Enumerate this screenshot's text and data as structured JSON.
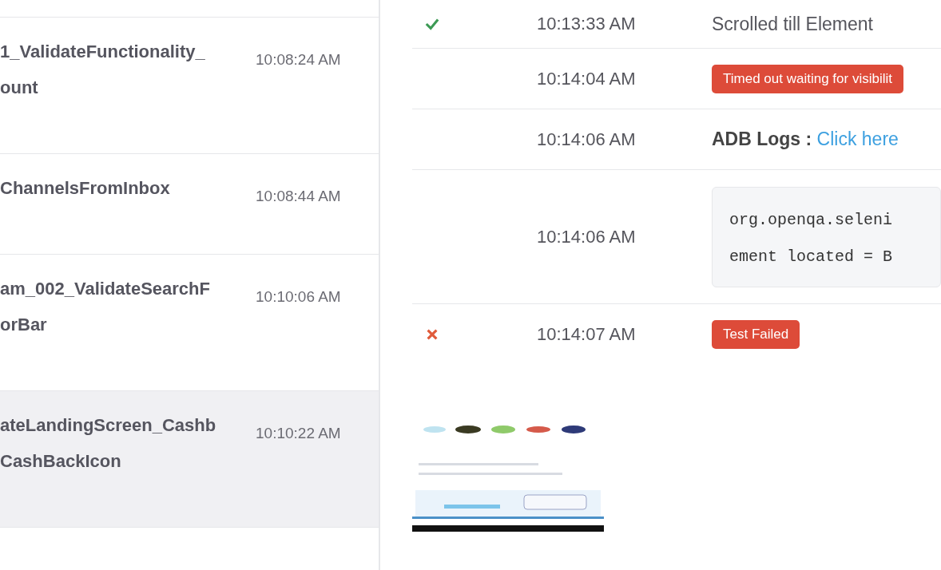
{
  "tests": [
    {
      "name_lines": [
        "1_ValidateFunctionality_",
        "ount"
      ],
      "time": "10:08:24 AM",
      "selected": false
    },
    {
      "name_lines": [
        "ChannelsFromInbox"
      ],
      "time": "10:08:44 AM",
      "selected": false
    },
    {
      "name_lines": [
        "am_002_ValidateSearchF",
        "orBar"
      ],
      "time": "10:10:06 AM",
      "selected": false
    },
    {
      "name_lines": [
        "ateLandingScreen_Cashb",
        "CashBackIcon"
      ],
      "time": "10:10:22 AM",
      "selected": true
    }
  ],
  "log": [
    {
      "passed": true,
      "time": "10:13:33 AM",
      "kind": "text",
      "text": "Scrolled till Element"
    },
    {
      "time": "10:14:04 AM",
      "kind": "badge",
      "text": "Timed out waiting for visibilit"
    },
    {
      "time": "10:14:06 AM",
      "kind": "link",
      "label": "ADB Logs :",
      "link": "Click here"
    },
    {
      "time": "10:14:06 AM",
      "kind": "code",
      "lines": [
        "org.openqa.seleni",
        "ement located = B"
      ]
    },
    {
      "failed": true,
      "time": "10:14:07 AM",
      "kind": "badge",
      "text": "Test Failed"
    }
  ]
}
